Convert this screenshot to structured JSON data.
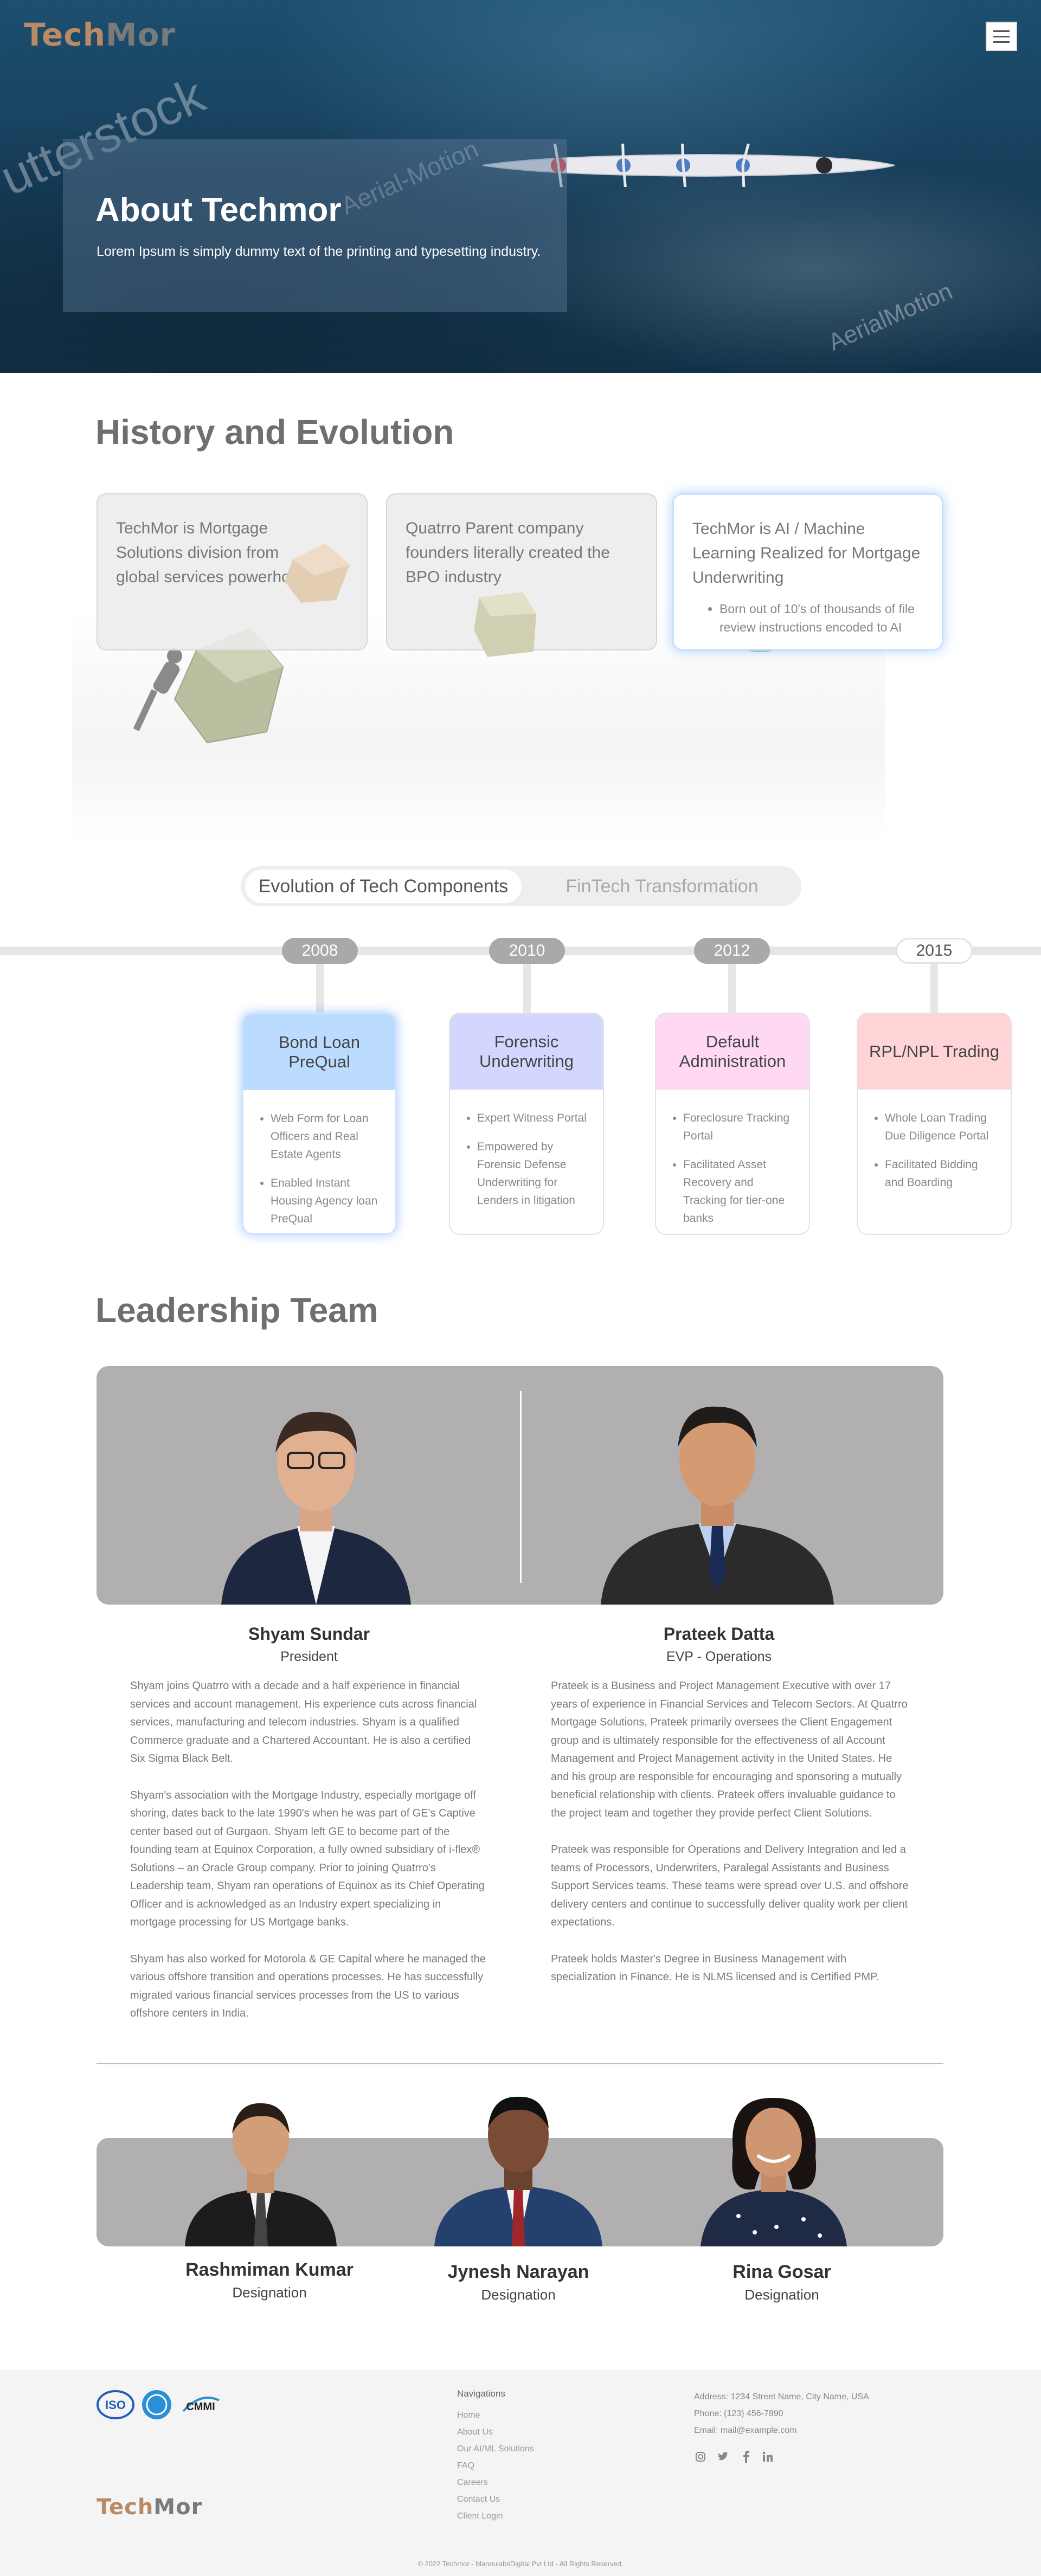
{
  "brand": {
    "logo_part1": "Tech",
    "logo_part2": "Mor"
  },
  "hero": {
    "title": "About Techmor",
    "subtitle": "Lorem Ipsum is simply dummy text of the printing and typesetting industry.",
    "watermarks": [
      "utterstock",
      "Aerial-Motion",
      "AerialMotion"
    ]
  },
  "history": {
    "title": "History and Evolution",
    "cards": [
      {
        "text": "TechMor is Mortgage Solutions division from global services powerhouse",
        "bullets": []
      },
      {
        "text": "Quatrro Parent company founders literally created the BPO industry",
        "bullets": []
      },
      {
        "text": "TechMor is AI / Machine Learning  Realized for Mortgage Underwriting",
        "bullets": [
          "Born out of 10's of thousands of file review instructions encoded to AI"
        ]
      }
    ]
  },
  "tabs": {
    "active": "Evolution of Tech Components",
    "inactive": "FinTech Transformation"
  },
  "timeline": [
    {
      "year": "2008",
      "title": "Bond Loan PreQual",
      "header_color": "#bcdcff",
      "bullets": [
        "Web Form for Loan Officers and Real Estate Agents",
        "Enabled Instant Housing Agency loan PreQual"
      ]
    },
    {
      "year": "2010",
      "title": "Forensic Underwriting",
      "header_color": "#d3d6ff",
      "bullets": [
        "Expert Witness Portal",
        "Empowered by Forensic Defense Underwriting for Lenders in litigation"
      ]
    },
    {
      "year": "2012",
      "title": "Default Administration",
      "header_color": "#ffd9f3",
      "bullets": [
        "Foreclosure Tracking Portal",
        "Facilitated Asset Recovery and Tracking for tier-one banks"
      ]
    },
    {
      "year": "2015",
      "title": "RPL/NPL Trading",
      "header_color": "#ffd4d6",
      "bullets": [
        "Whole Loan Trading Due Diligence Portal",
        "Facilitated Bidding and Boarding"
      ]
    }
  ],
  "leadership": {
    "title": "Leadership Team",
    "leaders": [
      {
        "name": "Shyam Sundar",
        "role": "President",
        "bio": [
          "Shyam joins Quatrro with a decade and a half experience in financial services and account management. His experience cuts across financial services, manufacturing and telecom industries. Shyam is a qualified Commerce graduate and a Chartered Accountant. He is also a certified Six Sigma Black Belt.",
          "Shyam's association with the Mortgage Industry, especially mortgage off shoring, dates back to the late 1990's when he was part of GE's Captive center based out of Gurgaon. Shyam left GE to become part of the founding team at Equinox Corporation, a fully owned subsidiary of i-flex® Solutions – an Oracle Group company. Prior to joining Quatrro's Leadership team, Shyam ran operations of Equinox as its Chief Operating Officer and is acknowledged as an Industry expert specializing in mortgage processing for US Mortgage banks.",
          "Shyam has also worked for Motorola & GE Capital where he managed the various offshore transition and operations processes. He has successfully migrated various financial services processes from the US to various offshore centers in India."
        ]
      },
      {
        "name": "Prateek Datta",
        "role": "EVP - Operations",
        "bio": [
          "Prateek is a Business and Project Management Executive with over 17 years of experience in Financial Services and Telecom Sectors. At Quatrro Mortgage Solutions, Prateek primarily oversees the Client Engagement group and is ultimately responsible for the effectiveness of all Account Management and Project Management activity in the United States. He and his group are responsible for encouraging and sponsoring a mutually beneficial relationship with clients. Prateek offers invaluable guidance to the project team and together they provide perfect Client Solutions.",
          "Prateek was responsible for Operations and Delivery Integration and led a teams of Processors, Underwriters, Paralegal Assistants and Business Support Services teams. These teams were spread over U.S. and offshore delivery centers and continue to successfully deliver quality work per client expectations.",
          "Prateek holds Master's Degree in Business Management with specialization in Finance. He is NLMS licensed and is Certified PMP."
        ]
      }
    ],
    "team": [
      {
        "name": "Rashmiman Kumar",
        "role": "Designation"
      },
      {
        "name": "Jynesh Narayan",
        "role": "Designation"
      },
      {
        "name": "Rina Gosar",
        "role": "Designation"
      }
    ]
  },
  "footer": {
    "badges": [
      "ISO",
      "CMMI"
    ],
    "nav_title": "Navigations",
    "nav": [
      "Home",
      "About Us",
      "Our AI/ML Solutions",
      "FAQ",
      "Careers",
      "Contact Us",
      "Client Login"
    ],
    "address": "Address: 1234 Street Name, City Name, USA",
    "phone": "Phone: (123) 456-7890",
    "email": "Email: mail@example.com",
    "social": [
      "instagram-icon",
      "twitter-icon",
      "facebook-icon",
      "linkedin-icon"
    ],
    "copyright": "© 2022 Techmor - MannulabsDigital Pvt Ltd - All Rights Reserved."
  },
  "colors": {
    "accent_active_glow": "#64a0ff",
    "panel_grey": "#b1afb0",
    "logo_tech": "#b98a63",
    "logo_mor": "#7a7a7a"
  }
}
